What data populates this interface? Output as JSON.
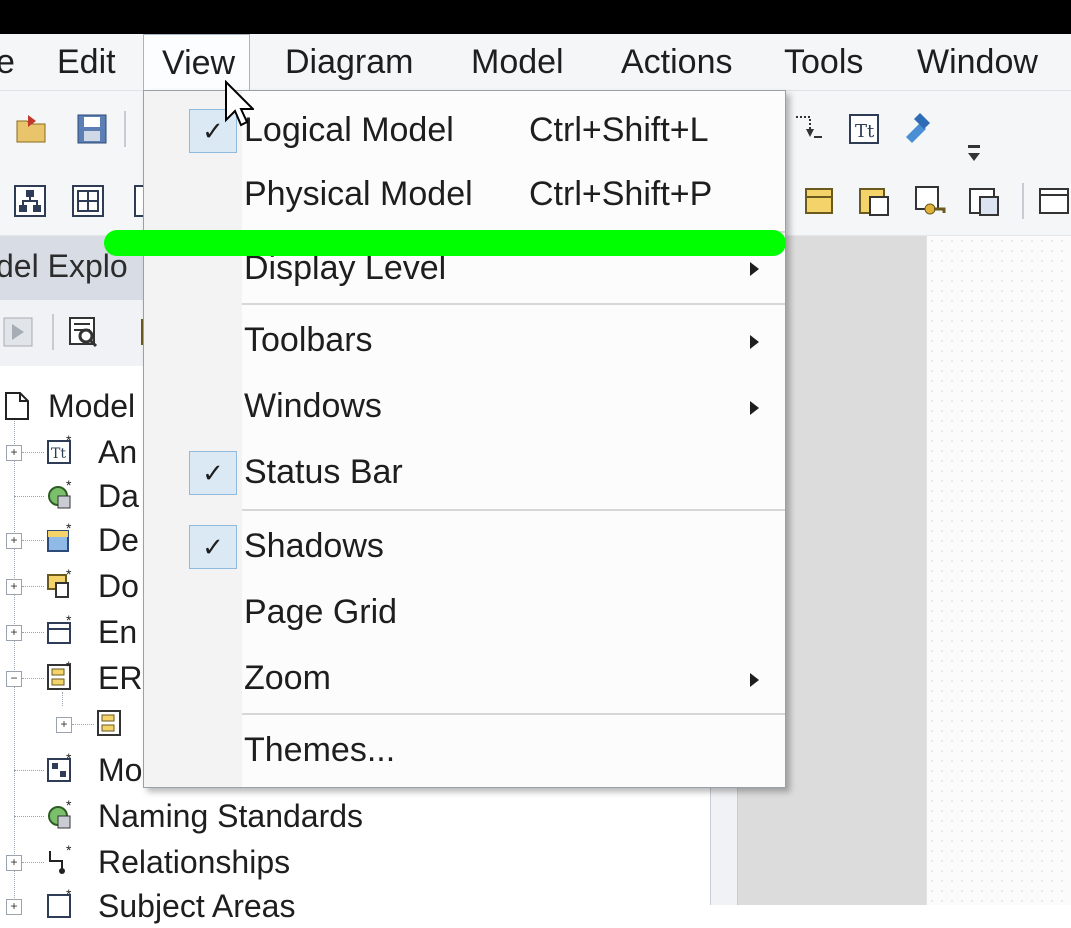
{
  "menubar": {
    "items": [
      "e",
      "Edit",
      "View",
      "Diagram",
      "Model",
      "Actions",
      "Tools",
      "Window"
    ]
  },
  "explorer": {
    "title": "del Explo",
    "tree": [
      {
        "label": "Model",
        "icon": "document-icon"
      },
      {
        "label": "An",
        "icon": "text-template-icon",
        "expandable": true
      },
      {
        "label": "Da",
        "icon": "gear-db-icon"
      },
      {
        "label": "De",
        "icon": "domain-icon",
        "expandable": true
      },
      {
        "label": "Do",
        "icon": "doc-star-icon",
        "expandable": true
      },
      {
        "label": "En",
        "icon": "entity-icon",
        "expandable": true
      },
      {
        "label": "ER",
        "icon": "er-diagram-icon",
        "expandable": true,
        "expanded": true
      },
      {
        "label": "",
        "icon": "er-child-icon",
        "expandable": true
      },
      {
        "label": "Mo",
        "icon": "model-source-icon"
      },
      {
        "label": "Naming Standards",
        "icon": "gear-db-icon"
      },
      {
        "label": "Relationships",
        "icon": "relationship-icon",
        "expandable": true
      },
      {
        "label": "Subject Areas",
        "icon": "subject-area-icon",
        "expandable": true
      }
    ]
  },
  "view_menu": {
    "items": [
      {
        "label": "Logical Model",
        "shortcut": "Ctrl+Shift+L",
        "checked": true
      },
      {
        "label": "Physical Model",
        "shortcut": "Ctrl+Shift+P",
        "checked": false
      },
      {
        "label": "Display Level",
        "submenu": true
      },
      {
        "label": "Toolbars",
        "submenu": true
      },
      {
        "label": "Windows",
        "submenu": true
      },
      {
        "label": "Status Bar",
        "checked": true
      },
      {
        "label": "Shadows",
        "checked": true
      },
      {
        "label": "Page Grid",
        "checked": false
      },
      {
        "label": "Zoom",
        "submenu": true
      },
      {
        "label": "Themes..."
      }
    ]
  },
  "colors": {
    "highlight": "#00ff00",
    "check_bg": "#dbe9f5"
  }
}
